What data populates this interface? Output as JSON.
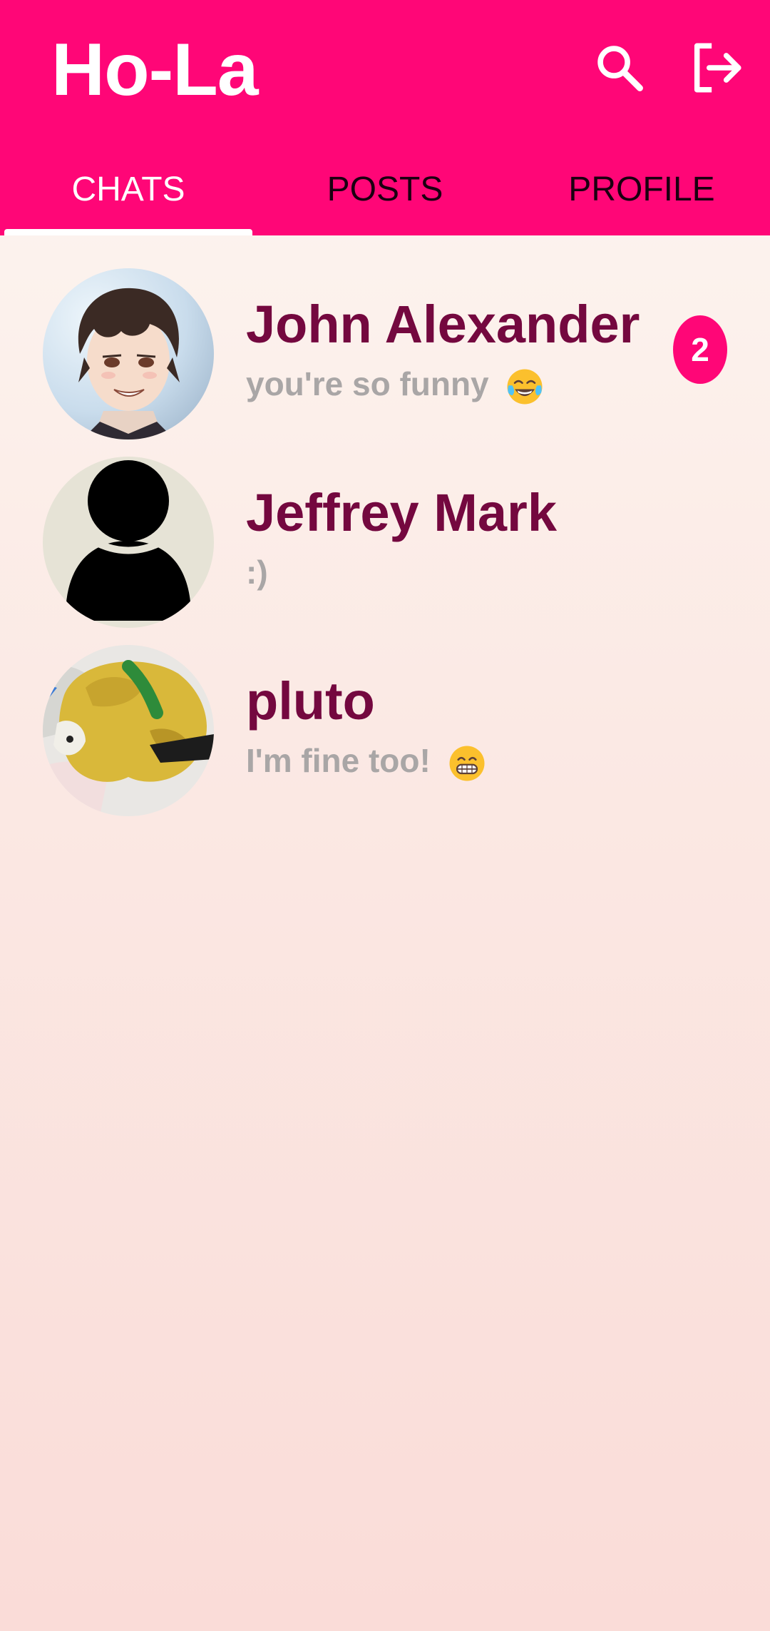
{
  "app": {
    "title": "Ho-La",
    "accent_color": "#ff0677",
    "name_color": "#74083f",
    "preview_color": "#a9a6a6"
  },
  "header": {
    "actions": [
      {
        "icon": "search-icon",
        "label": "search"
      },
      {
        "icon": "logout-icon",
        "label": "logout"
      }
    ]
  },
  "tabs": [
    {
      "label": "CHATS",
      "active": true
    },
    {
      "label": "POSTS",
      "active": false
    },
    {
      "label": "PROFILE",
      "active": false
    }
  ],
  "chats": [
    {
      "name": "John Alexander",
      "last_message": "you're so funny",
      "emoji": "face-with-tears-of-joy-icon",
      "unread": "2",
      "avatar": "anime-character-photo"
    },
    {
      "name": "Jeffrey Mark",
      "last_message": ":)",
      "emoji": "",
      "unread": "",
      "avatar": "default-person-icon"
    },
    {
      "name": "pluto",
      "last_message": "I'm fine too!",
      "emoji": "grinning-face-icon",
      "unread": "",
      "avatar": "plush-toy-photo"
    }
  ]
}
